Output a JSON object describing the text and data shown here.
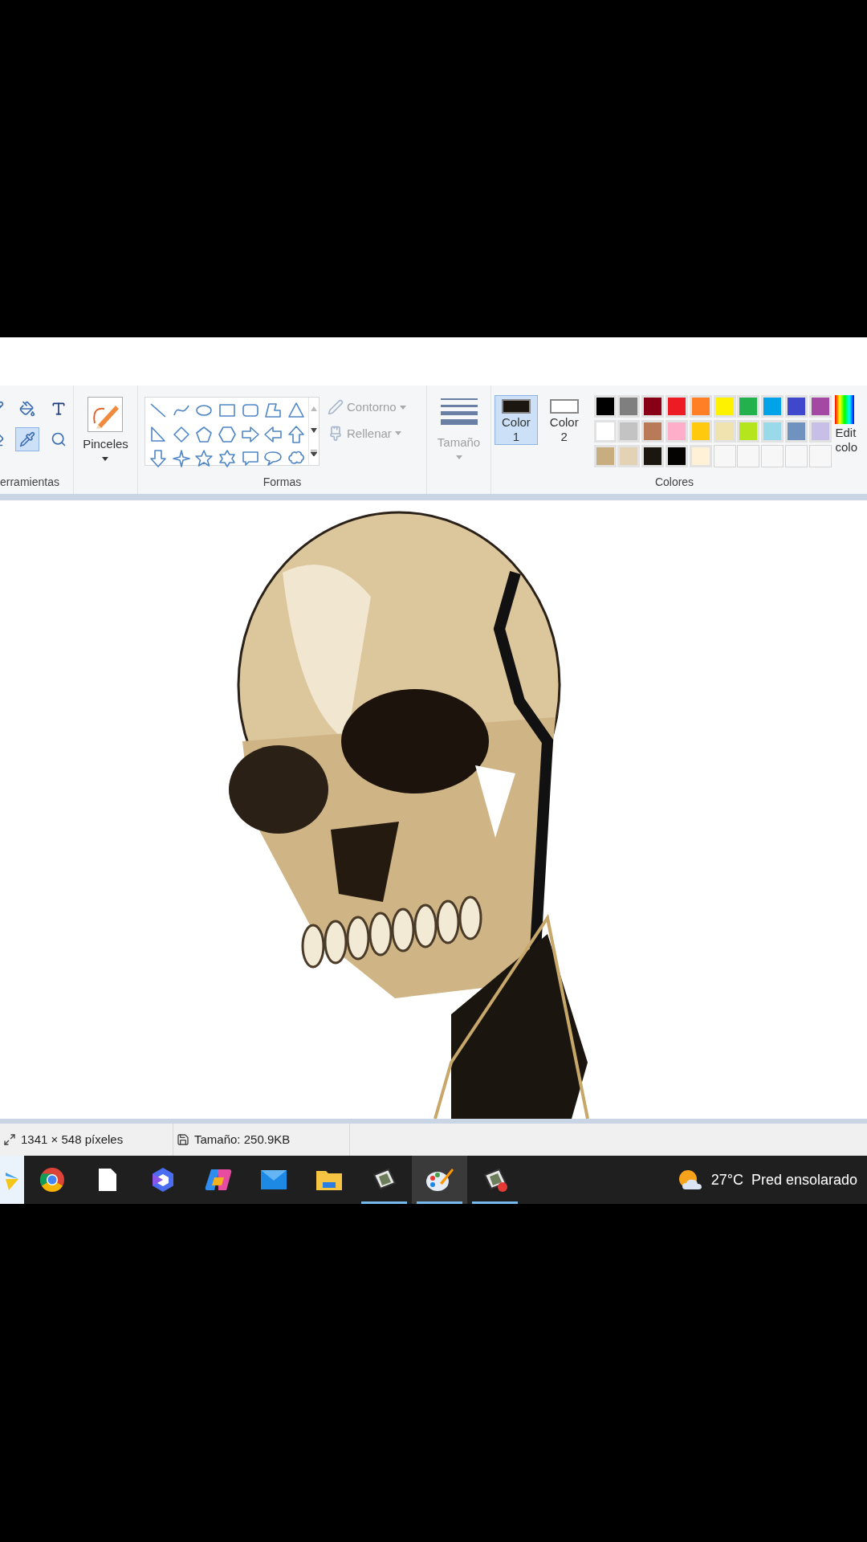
{
  "ribbon": {
    "tools_group": {
      "label": "erramientas",
      "tools": [
        {
          "kind": "pencil",
          "selected": false
        },
        {
          "kind": "fill",
          "selected": false
        },
        {
          "kind": "text",
          "selected": false
        },
        {
          "kind": "eraser",
          "selected": false
        },
        {
          "kind": "picker",
          "selected": true
        },
        {
          "kind": "magnifier",
          "selected": false
        }
      ]
    },
    "brushes": {
      "label": "Pinceles"
    },
    "shapes_group": {
      "label": "Formas",
      "outline": {
        "label": "Contorno",
        "disabled": true
      },
      "fill": {
        "label": "Rellenar",
        "disabled": true
      }
    },
    "size": {
      "label": "Tamaño",
      "disabled": true
    },
    "colors_group": {
      "label": "Colores",
      "color1": {
        "label_1": "Color",
        "label_2": "1",
        "color": "#1c1610",
        "selected": true
      },
      "color2": {
        "label_1": "Color",
        "label_2": "2",
        "color": "#ffffff",
        "selected": false
      },
      "palette": [
        {
          "kind": "color",
          "color": "#000000"
        },
        {
          "kind": "color",
          "color": "#7f7f7f"
        },
        {
          "kind": "color",
          "color": "#880015"
        },
        {
          "kind": "color",
          "color": "#ed1c24"
        },
        {
          "kind": "color",
          "color": "#ff7f27"
        },
        {
          "kind": "color",
          "color": "#fff200"
        },
        {
          "kind": "color",
          "color": "#22b14c"
        },
        {
          "kind": "color",
          "color": "#00a2e8"
        },
        {
          "kind": "color",
          "color": "#3f48cc"
        },
        {
          "kind": "color",
          "color": "#a349a4"
        },
        {
          "kind": "color",
          "color": "#ffffff"
        },
        {
          "kind": "color",
          "color": "#c3c3c3"
        },
        {
          "kind": "color",
          "color": "#b97a57"
        },
        {
          "kind": "color",
          "color": "#ffaec9"
        },
        {
          "kind": "color",
          "color": "#ffc90e"
        },
        {
          "kind": "color",
          "color": "#efe4b0"
        },
        {
          "kind": "color",
          "color": "#b5e61d"
        },
        {
          "kind": "color",
          "color": "#99d9ea"
        },
        {
          "kind": "color",
          "color": "#7092be"
        },
        {
          "kind": "color",
          "color": "#c8bfe7"
        },
        {
          "kind": "color",
          "color": "#c8ad7f"
        },
        {
          "kind": "color",
          "color": "#e3d3b4"
        },
        {
          "kind": "color",
          "color": "#1c1610"
        },
        {
          "kind": "color",
          "color": "#050302"
        },
        {
          "kind": "color",
          "color": "#fff0d8"
        },
        {
          "kind": "empty"
        },
        {
          "kind": "empty"
        },
        {
          "kind": "empty"
        },
        {
          "kind": "empty"
        },
        {
          "kind": "empty"
        }
      ],
      "edit_colors": {
        "line_1": "Edit",
        "line_2": "colo"
      }
    }
  },
  "status_bar": [
    {
      "kind": "dimensions",
      "text": "1341 × 548 píxeles"
    },
    {
      "kind": "file_size",
      "text": "Tamaño: 250.9KB"
    }
  ],
  "taskbar": {
    "apps": [
      {
        "kind": "start",
        "running": false,
        "selected": false
      },
      {
        "kind": "chrome",
        "running": false,
        "selected": false
      },
      {
        "kind": "document",
        "running": false,
        "selected": false
      },
      {
        "kind": "hexagon",
        "running": false,
        "selected": false
      },
      {
        "kind": "copilot",
        "running": false,
        "selected": false
      },
      {
        "kind": "mail",
        "running": false,
        "selected": false
      },
      {
        "kind": "folder",
        "running": false,
        "selected": false
      },
      {
        "kind": "drawing",
        "running": true,
        "selected": false
      },
      {
        "kind": "paint",
        "running": true,
        "selected": true
      },
      {
        "kind": "drawing_alert",
        "running": true,
        "selected": false
      }
    ],
    "weather": {
      "temperature": "27°C",
      "condition": "Pred ensolarado"
    }
  }
}
